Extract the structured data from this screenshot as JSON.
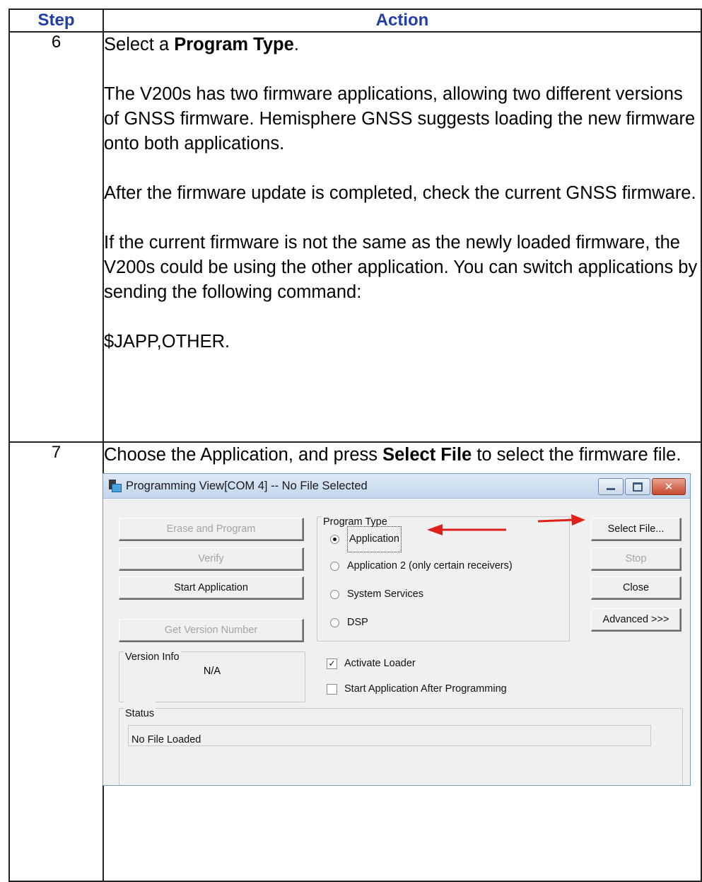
{
  "table": {
    "headers": {
      "step": "Step",
      "action": "Action"
    },
    "row6": {
      "step": "6",
      "line1_prefix": "Select a ",
      "line1_bold": "Program Type",
      "line1_suffix": ".",
      "para2": "The V200s has two firmware applications, allowing two different versions of GNSS firmware. Hemisphere GNSS suggests loading the new firmware onto both applications.",
      "para3": "After the firmware update is completed, check the current GNSS firmware.",
      "para4": "If the current firmware is not the same as the newly loaded firmware, the V200s could be using the other application. You can switch applications by sending the following command:",
      "para5": "$JAPP,OTHER."
    },
    "row7": {
      "step": "7",
      "prefix": "Choose the Application, and press ",
      "bold": "Select File",
      "suffix": " to select the firmware file."
    }
  },
  "dialog": {
    "title": "Programming View[COM 4] -- No File Selected",
    "buttons": {
      "erase_program": "Erase and Program",
      "verify": "Verify",
      "start_application": "Start Application",
      "get_version": "Get Version Number",
      "select_file": "Select File...",
      "stop": "Stop",
      "close": "Close",
      "advanced": "Advanced >>>"
    },
    "program_type": {
      "label": "Program Type",
      "options": [
        "Application",
        "Application 2 (only certain receivers)",
        "System Services",
        "DSP"
      ],
      "selected": "Application"
    },
    "version_info": {
      "label": "Version Info",
      "value": "N/A"
    },
    "checkboxes": {
      "activate_loader": {
        "label": "Activate Loader",
        "checked": true
      },
      "start_after": {
        "label": "Start Application After Programming",
        "checked": false
      }
    },
    "status": {
      "label": "Status",
      "value": "No File Loaded"
    },
    "annotation_color": "#e0201b"
  }
}
